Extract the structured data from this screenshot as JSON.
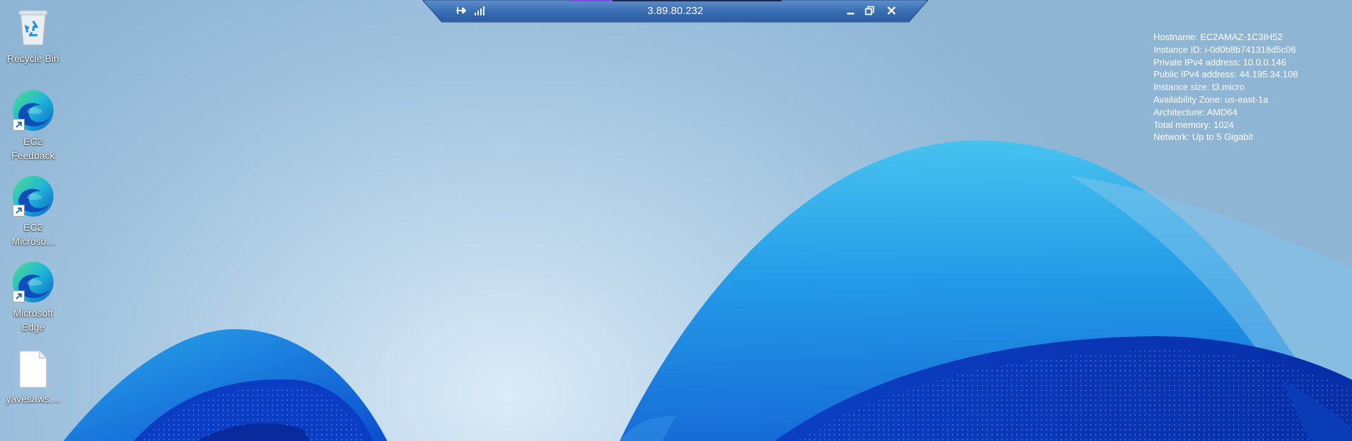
{
  "desktop": {
    "icons": [
      {
        "label": "Recycle Bin",
        "icon": "recycle-bin-icon"
      },
      {
        "label": "EC2 Feedback",
        "icon": "edge-shortcut-icon"
      },
      {
        "label": "EC2 Microso...",
        "icon": "edge-shortcut-icon"
      },
      {
        "label": "Microsoft Edge",
        "icon": "edge-shortcut-icon"
      },
      {
        "label": "yavesaws....",
        "icon": "file-icon"
      }
    ]
  },
  "rdp_bar": {
    "host": "3.89.80.232",
    "icons": [
      "pin-icon",
      "connection-quality-icon",
      "minimize-icon",
      "restore-icon",
      "close-icon"
    ]
  },
  "instance_info": {
    "hostname": "Hostname: EC2AMAZ-1C3IH52",
    "instance_id": "Instance ID: i-0d0b8b741318d5c06",
    "private_ip": "Private IPv4 address: 10.0.0.146",
    "public_ip": "Public IPv4 address: 44.195.34.108",
    "instance_size": "Instance size: t3.micro",
    "availability_zone": "Availability Zone: us-east-1a",
    "architecture": "Architecture: AMD64",
    "total_memory": "Total memory: 1024",
    "network": "Network: Up to 5 Gigabit"
  },
  "colors": {
    "wallpaper_light": "#dcebf6",
    "wallpaper_mid": "#9fc2de",
    "bloom_blue": "#1a8ee6",
    "bloom_deep": "#0a3dc2",
    "rdp_bar": "#2d62a8"
  }
}
